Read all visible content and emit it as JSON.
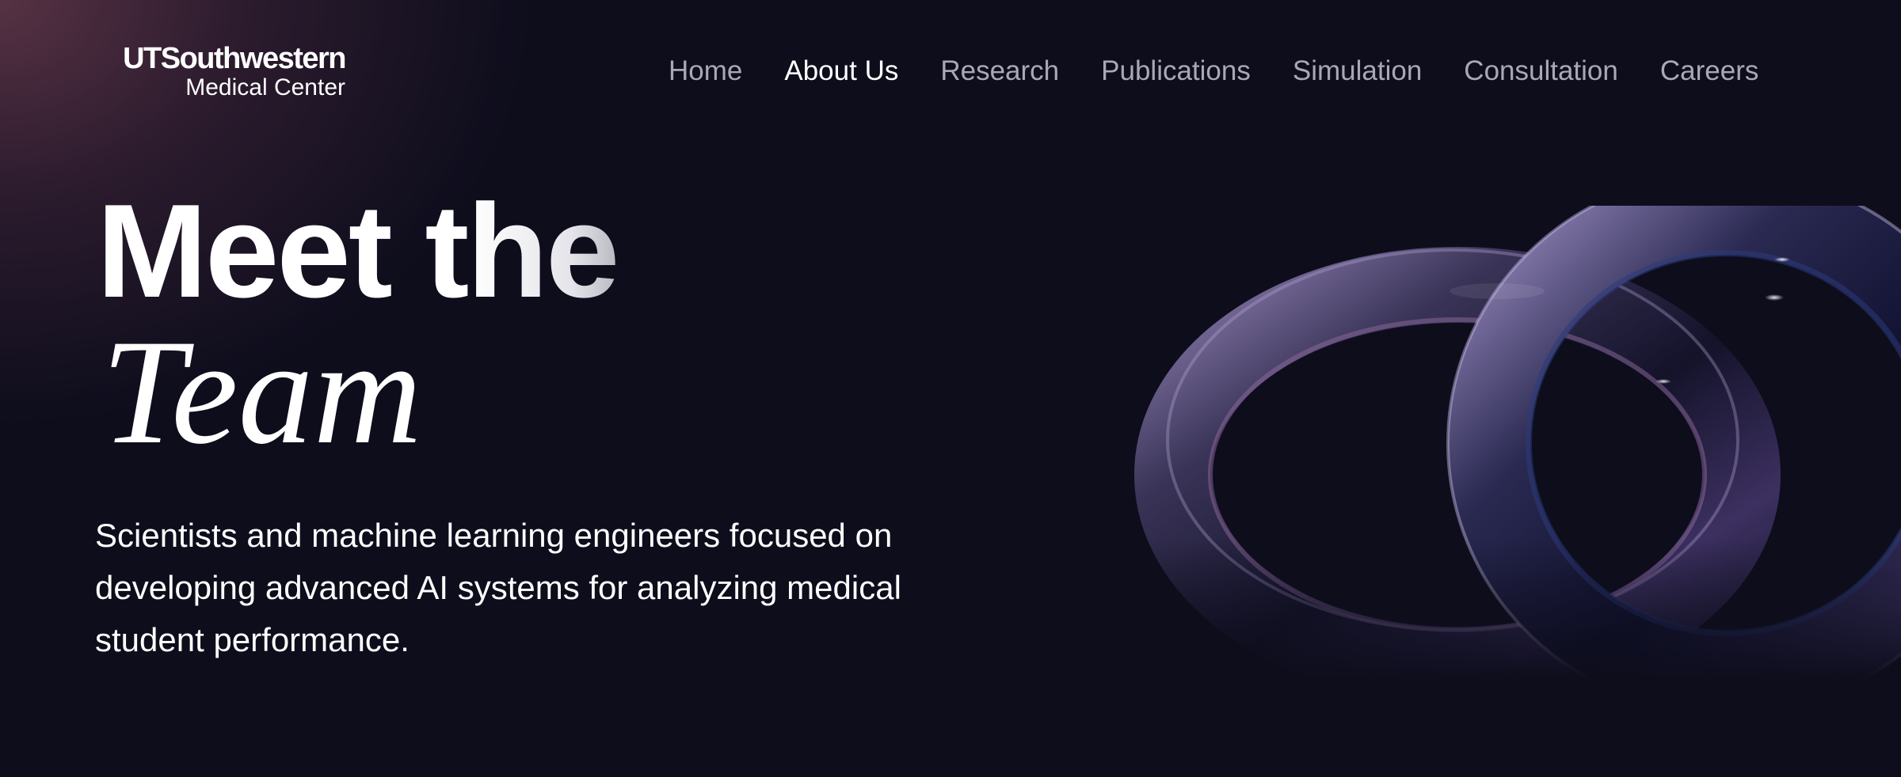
{
  "brand": {
    "logo_line1": "UTSouthwestern",
    "logo_line2": "Medical Center"
  },
  "nav": {
    "items": [
      {
        "label": "Home",
        "active": false
      },
      {
        "label": "About Us",
        "active": true
      },
      {
        "label": "Research",
        "active": false
      },
      {
        "label": "Publications",
        "active": false
      },
      {
        "label": "Simulation",
        "active": false
      },
      {
        "label": "Consultation",
        "active": false
      },
      {
        "label": "Careers",
        "active": false
      }
    ]
  },
  "hero": {
    "title_line1": "Meet the",
    "title_line2": "Team",
    "description": "Scientists and machine learning engineers focused on developing advanced AI systems for analyzing medical student performance."
  },
  "colors": {
    "background": "#0d0d1c",
    "glow": "#5a3446",
    "nav_inactive": "#a9a9b6",
    "nav_active": "#ffffff",
    "ring_tint": "#7a6a9e"
  },
  "decor": {
    "hero_art": "interlocking-glass-rings"
  }
}
